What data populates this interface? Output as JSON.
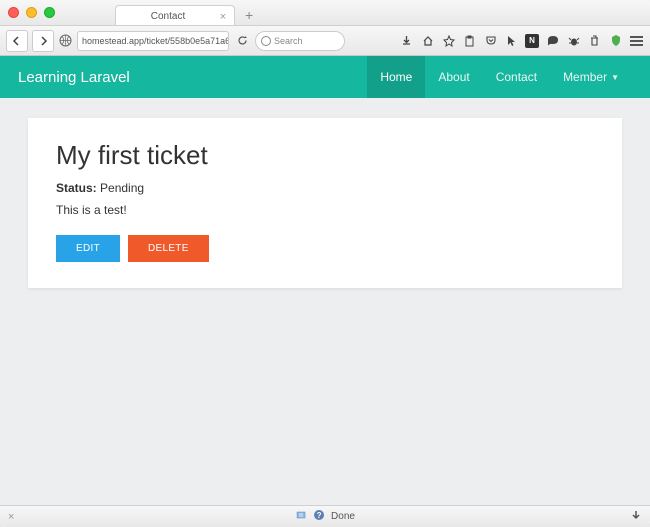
{
  "browser": {
    "tab_title": "Contact",
    "url": "homestead.app/ticket/558b0e5a71a6b",
    "search_placeholder": "Search",
    "status_text": "Done"
  },
  "navbar": {
    "brand": "Learning Laravel",
    "links": [
      {
        "label": "Home",
        "active": true
      },
      {
        "label": "About",
        "active": false
      },
      {
        "label": "Contact",
        "active": false
      },
      {
        "label": "Member",
        "active": false,
        "dropdown": true
      }
    ]
  },
  "ticket": {
    "title": "My first ticket",
    "status_label": "Status:",
    "status_value": "Pending",
    "body": "This is a test!",
    "edit_label": "EDIT",
    "delete_label": "DELETE"
  }
}
